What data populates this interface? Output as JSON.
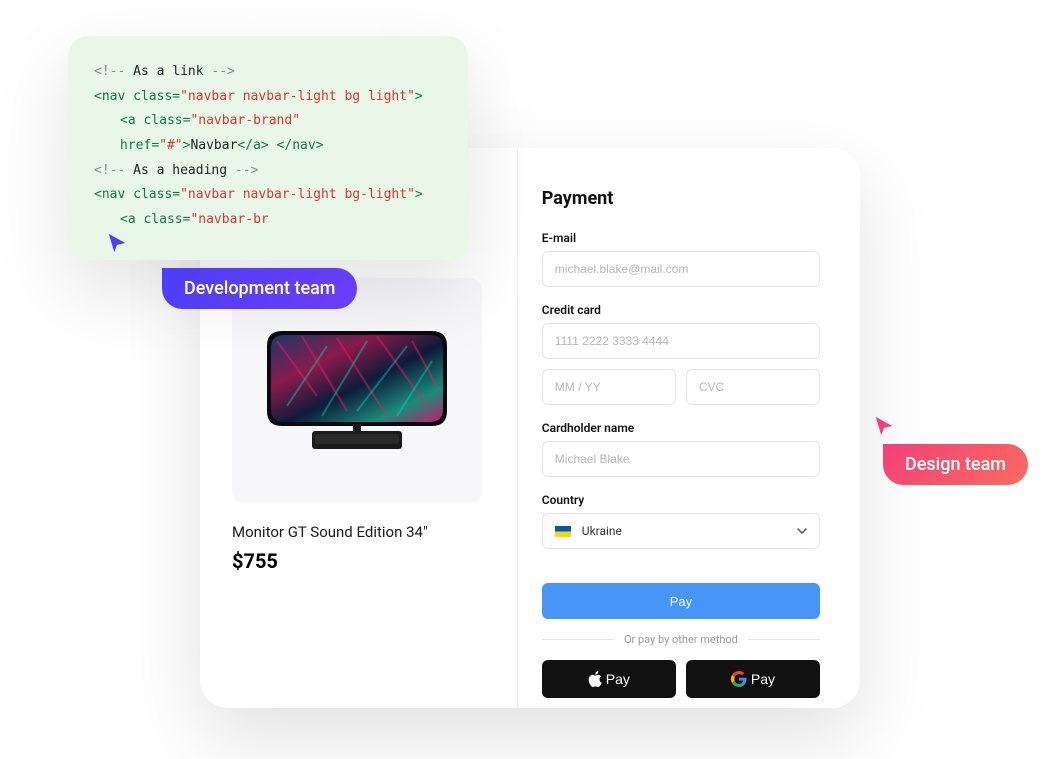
{
  "badges": {
    "dev": "Development team",
    "design": "Design team"
  },
  "code": {
    "l1": {
      "cm1": "<!--",
      "cm2": " As a link ",
      "cm3": "-->"
    },
    "l2": {
      "t1": "<nav",
      "a1": " class",
      "s1": "\"navbar navbar-light bg light\"",
      "t2": ">"
    },
    "l3": {
      "t1": "<a",
      "a1": " class",
      "s1": "\"navbar-brand\""
    },
    "l4": {
      "a1": "href",
      "s1": "\"#\"",
      "t1": ">",
      "txt": "Navbar",
      "t2": "</a>",
      "t3": " </nav>"
    },
    "l5": {
      "cm1": "<!--",
      "cm2": " As a heading ",
      "cm3": "-->"
    },
    "l6": {
      "t1": "<nav",
      "a1": " class",
      "s1": "\"navbar navbar-light bg-light\"",
      "t2": ">"
    },
    "l7": {
      "t1": "<a",
      "a1": " class",
      "s1": "\"navbar-br"
    }
  },
  "product": {
    "name": "Monitor GT Sound Edition 34\"",
    "price": "$755"
  },
  "payment": {
    "title": "Payment",
    "email_label": "E-mail",
    "email_placeholder": "michael.blake@mail.com",
    "card_label": "Credit card",
    "card_placeholder": "1111 2222 3333 4444",
    "expiry_placeholder": "MM / YY",
    "cvc_placeholder": "CVC",
    "name_label": "Cardholder name",
    "name_placeholder": "Michael Blake",
    "country_label": "Country",
    "country_value": "Ukraine",
    "pay_button": "Pay",
    "divider_text": "Or pay by other method",
    "apple_pay": "Pay",
    "google_pay": "Pay"
  }
}
